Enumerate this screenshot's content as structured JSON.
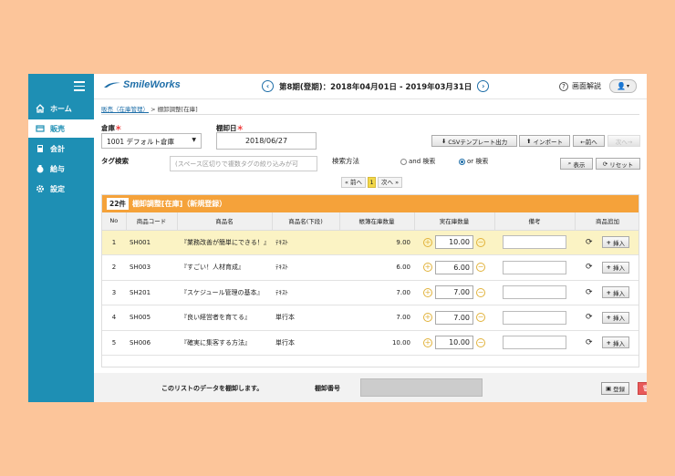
{
  "sidebar": {
    "items": [
      {
        "label": "ホーム",
        "icon": "home-icon"
      },
      {
        "label": "販売",
        "icon": "sales-icon"
      },
      {
        "label": "会計",
        "icon": "accounting-icon"
      },
      {
        "label": "給与",
        "icon": "payroll-icon"
      },
      {
        "label": "設定",
        "icon": "gear-icon"
      }
    ]
  },
  "header": {
    "logo": "SmileWorks",
    "period": "第8期(登期)：2018年04月01日 - 2019年03月31日",
    "help": "画面解説"
  },
  "breadcrumb": {
    "link": "販売（在庫管理）",
    "separator": " > ",
    "current": "棚卸調整[在庫]"
  },
  "form": {
    "warehouse_label": "倉庫",
    "warehouse_value": "1001 デフォルト倉庫",
    "date_label": "棚卸日",
    "date_value": "2018/06/27",
    "tag_label": "タグ検索",
    "tag_placeholder": "(スペース区切りで複数タグの絞り込みが可",
    "search_method_label": "検索方法",
    "and_label": "and 検索",
    "or_label": "or 検索",
    "required_mark": "＊"
  },
  "toolbar": {
    "csv": "CSVテンプレート出力",
    "import": "インポート",
    "prev": "←前へ",
    "next": "次へ→",
    "display": "表示",
    "reset": "リセット"
  },
  "pager": {
    "prev": "« 前へ",
    "current": "1",
    "next": "次へ »"
  },
  "table": {
    "count": "22件",
    "title": "棚卸調整[在庫]（新規登録）",
    "headers": [
      "No",
      "商品コード",
      "商品名",
      "商品名(下段)",
      "帳簿在庫数量",
      "実在庫数量",
      "備考",
      "商品追加"
    ],
    "insert_label": "挿入",
    "rows": [
      {
        "no": "1",
        "code": "SH001",
        "name": "『業務改善が簡単にできる！』",
        "sub": "ﾃｷｽﾄ",
        "book": "9.00",
        "actual": "10.00"
      },
      {
        "no": "2",
        "code": "SH003",
        "name": "『すごい！人材育成』",
        "sub": "ﾃｷｽﾄ",
        "book": "6.00",
        "actual": "6.00"
      },
      {
        "no": "3",
        "code": "SH201",
        "name": "『スケジュール管理の基本』",
        "sub": "ﾃｷｽﾄ",
        "book": "7.00",
        "actual": "7.00"
      },
      {
        "no": "4",
        "code": "SH005",
        "name": "『良い経営者を育てる』",
        "sub": "単行本",
        "book": "7.00",
        "actual": "7.00"
      },
      {
        "no": "5",
        "code": "SH006",
        "name": "『確実に集客する方法』",
        "sub": "単行本",
        "book": "10.00",
        "actual": "10.00"
      }
    ]
  },
  "footer": {
    "message": "このリストのデータを棚卸します。",
    "number_label": "棚卸番号",
    "register": "登録",
    "delete": "削除"
  },
  "colors": {
    "sidebar": "#1e8fb4",
    "accent": "#f5a23a",
    "highlight": "#fbf3c4",
    "delete": "#e85a5a"
  }
}
